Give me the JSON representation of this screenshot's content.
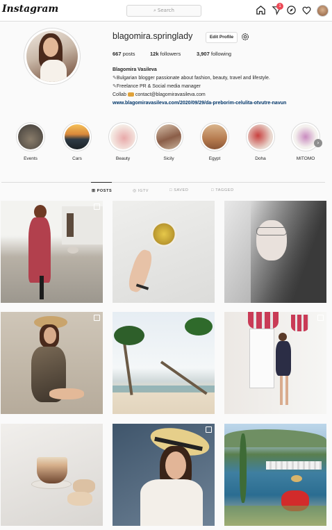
{
  "app": {
    "logo": "Instagram"
  },
  "search": {
    "placeholder": "Search"
  },
  "nav": {
    "notification_count": "1"
  },
  "profile": {
    "username": "blagomira.springlady",
    "edit_button": "Edit Profile",
    "stats": {
      "posts": "667",
      "posts_label": "posts",
      "followers": "12k",
      "followers_label": "followers",
      "following": "3,907",
      "following_label": "following"
    },
    "full_name": "Blagomira Vasileva",
    "bio_line1": "Bulgarian blogger passionate about fashion, beauty, travel and lifestyle.",
    "bio_line2": "Freelance PR & Social media manager",
    "bio_line3": "Collab",
    "contact": "contact@blagomiravasileva.com",
    "website": "www.blagomiravasileva.com/2020/09/29/da-preborim-celulita-otvutre-navun"
  },
  "highlights": [
    {
      "label": "Events"
    },
    {
      "label": "Cars"
    },
    {
      "label": "Beauty"
    },
    {
      "label": "Sicily"
    },
    {
      "label": "Egypt"
    },
    {
      "label": "Doha"
    },
    {
      "label": "MITOMO"
    }
  ],
  "tabs": {
    "posts": "POSTS",
    "igtv": "IGTV",
    "saved": "SAVED",
    "tagged": "TAGGED"
  },
  "colors": {
    "accent": "#0095f6",
    "link": "#003569",
    "badge": "#ed4956",
    "border": "#dbdbdb"
  }
}
